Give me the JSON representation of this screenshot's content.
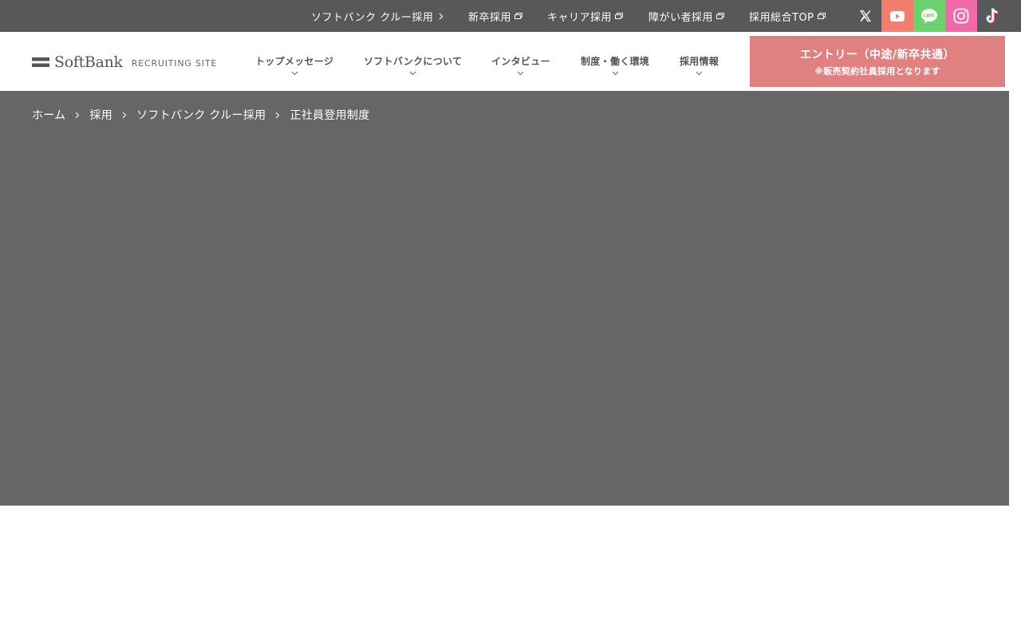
{
  "topbar": {
    "links": [
      {
        "label": "ソフトバンク クルー採用",
        "icon": "chevron-right-icon"
      },
      {
        "label": "新卒採用",
        "icon": "external-window-icon"
      },
      {
        "label": "キャリア採用",
        "icon": "external-window-icon"
      },
      {
        "label": "障がい者採用",
        "icon": "external-window-icon"
      },
      {
        "label": "採用総合TOP",
        "icon": "external-window-icon"
      }
    ],
    "social": [
      {
        "name": "x-icon",
        "bg": "#585858"
      },
      {
        "name": "youtube-icon",
        "bg": "#f47d6e"
      },
      {
        "name": "line-icon",
        "bg": "#6cd26c",
        "text": "LINE"
      },
      {
        "name": "instagram-icon",
        "bg": "#f06aa8"
      },
      {
        "name": "tiktok-icon",
        "bg": "#585858"
      }
    ]
  },
  "header": {
    "logo_text": "SoftBank",
    "logo_sub": "RECRUITING SITE",
    "nav": [
      {
        "label": "トップメッセージ"
      },
      {
        "label": "ソフトバンクについて"
      },
      {
        "label": "インタビュー"
      },
      {
        "label": "制度・働く環境"
      },
      {
        "label": "採用情報"
      }
    ],
    "entry": {
      "line1": "エントリー（中途/新卒共通）",
      "line2": "※販売契約社員採用となります"
    }
  },
  "breadcrumb": {
    "items": [
      "ホーム",
      "採用",
      "ソフトバンク クルー採用",
      "正社員登用制度"
    ]
  },
  "colors": {
    "topbar_bg": "#585858",
    "hero_bg": "#666666",
    "entry_bg": "#e08080"
  }
}
